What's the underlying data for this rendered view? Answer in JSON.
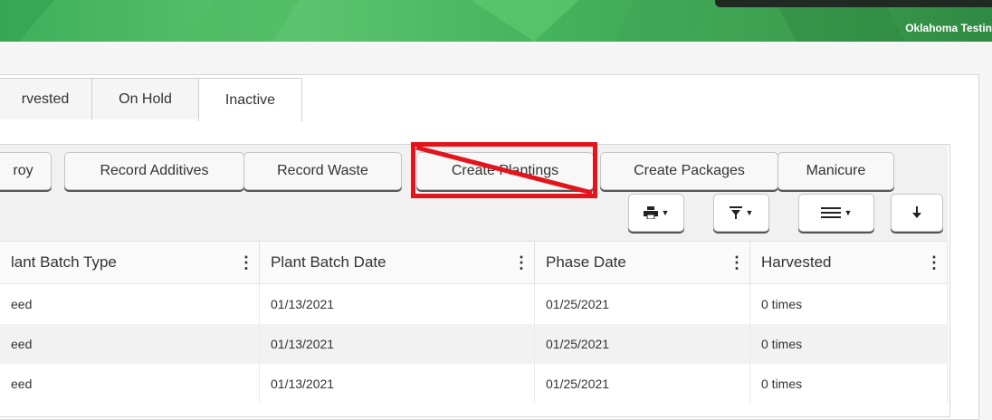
{
  "header": {
    "org_name": "Oklahoma Testin"
  },
  "tabs": [
    {
      "label": "rvested"
    },
    {
      "label": "On Hold"
    },
    {
      "label": "Inactive"
    }
  ],
  "actions": [
    {
      "label": "roy"
    },
    {
      "label": "Record Additives"
    },
    {
      "label": "Record Waste"
    },
    {
      "label": "Create Plantings"
    },
    {
      "label": "Create Packages"
    },
    {
      "label": "Manicure"
    }
  ],
  "tool_icons": [
    "printer-icon",
    "filter-icon",
    "columns-menu-icon",
    "download-icon"
  ],
  "annotation": {
    "color": "#e3141b"
  },
  "table": {
    "columns": [
      {
        "label": "lant Batch Type"
      },
      {
        "label": "Plant Batch Date"
      },
      {
        "label": "Phase Date"
      },
      {
        "label": "Harvested"
      }
    ],
    "rows": [
      [
        "eed",
        "01/13/2021",
        "01/25/2021",
        "0 times"
      ],
      [
        "eed",
        "01/13/2021",
        "01/25/2021",
        "0 times"
      ],
      [
        "eed",
        "01/13/2021",
        "01/25/2021",
        "0 times"
      ]
    ]
  }
}
